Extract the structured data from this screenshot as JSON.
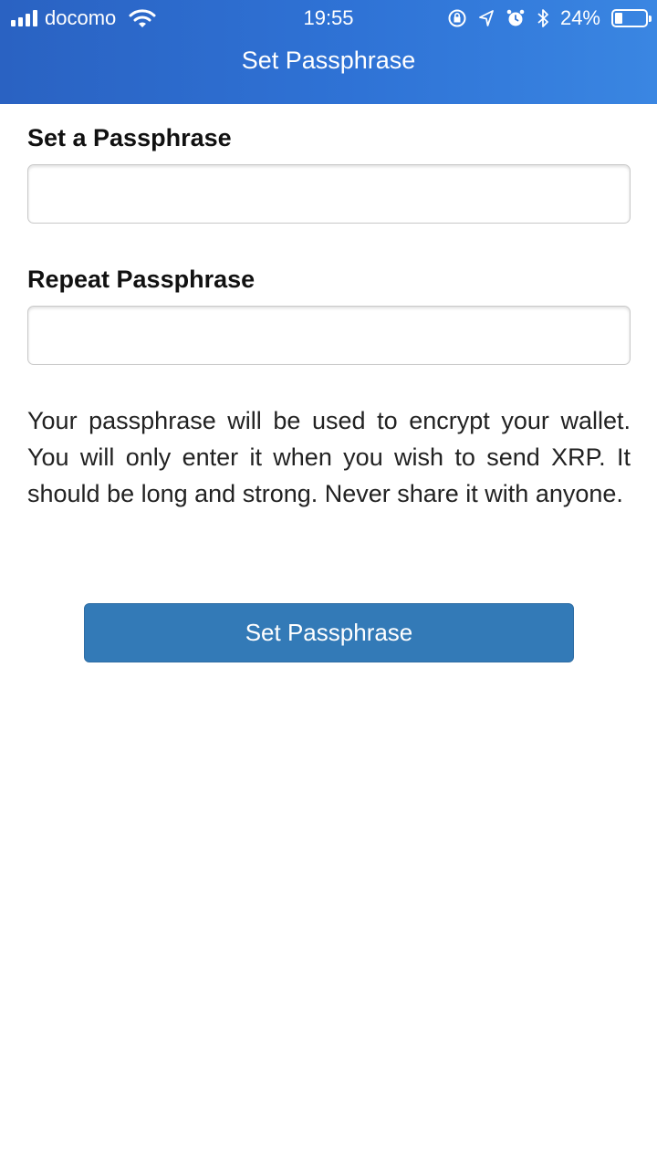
{
  "status_bar": {
    "carrier": "docomo",
    "time": "19:55",
    "battery_percent": "24%",
    "battery_level": 0.24,
    "icons": [
      "signal-icon",
      "wifi-icon",
      "orientation-lock-icon",
      "location-icon",
      "alarm-icon",
      "bluetooth-icon",
      "battery-icon"
    ]
  },
  "header": {
    "title": "Set Passphrase"
  },
  "form": {
    "passphrase_label": "Set a Passphrase",
    "passphrase_value": "",
    "repeat_label": "Repeat Passphrase",
    "repeat_value": "",
    "help_text": "Your passphrase will be used to encrypt your wallet. You will only enter it when you wish to send XRP. It should be long and strong. Never share it with anyone.",
    "submit_label": "Set Passphrase"
  },
  "colors": {
    "header_gradient_start": "#2a62c2",
    "header_gradient_end": "#3a86e2",
    "button": "#337ab7"
  }
}
